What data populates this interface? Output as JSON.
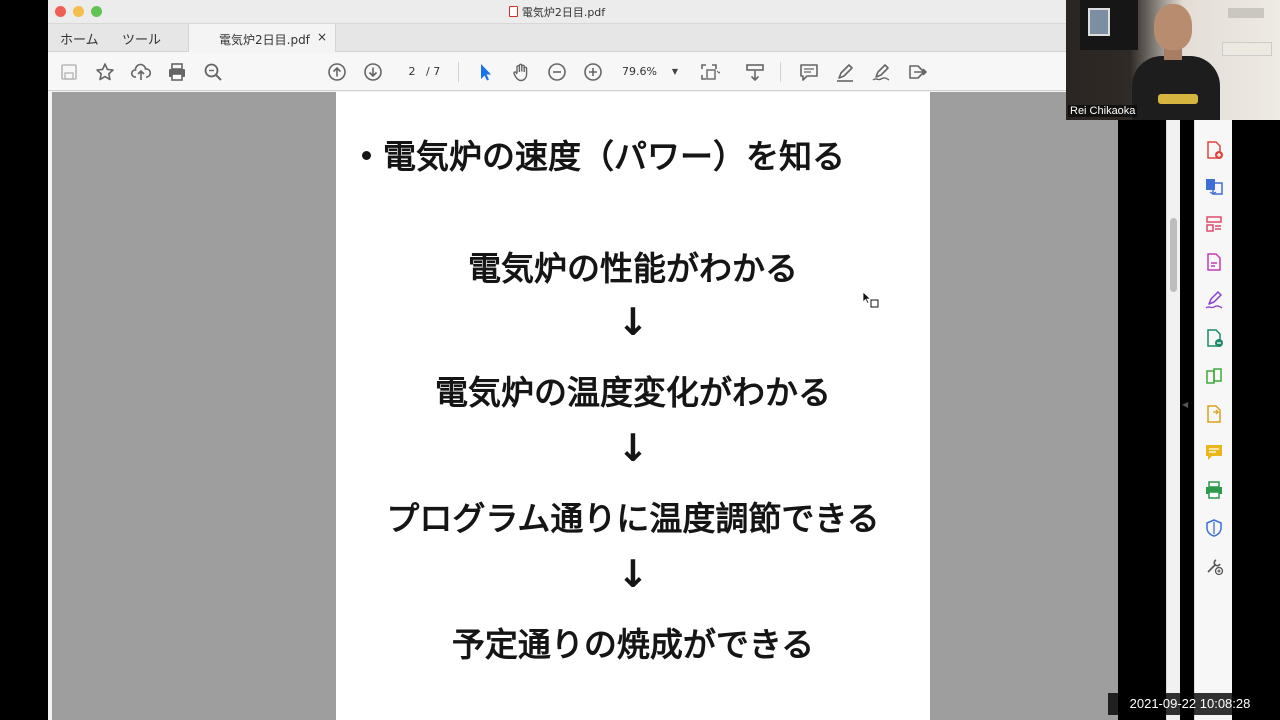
{
  "window": {
    "title": "電気炉2日目.pdf"
  },
  "tabs": {
    "home": "ホーム",
    "tools": "ツール",
    "document": "電気炉2日目.pdf",
    "close": "×"
  },
  "toolbar": {
    "current_page": "2",
    "total_pages": "/ 7",
    "zoom": "79.6%",
    "icons": [
      "save-icon",
      "bookmark-star-icon",
      "upload-icon",
      "print-icon",
      "zoom-search-icon",
      "page-up-icon",
      "page-down-icon",
      "select-cursor-icon",
      "hand-icon",
      "zoom-out-icon",
      "zoom-in-icon",
      "fit-page-icon",
      "scroll-mode-icon",
      "comment-icon",
      "highlight-pen-icon",
      "sign-icon",
      "share-icon"
    ]
  },
  "pdf": {
    "bullet": "電気炉の速度（パワー）を知る",
    "steps": [
      "電気炉の性能がわかる",
      "電気炉の温度変化がわかる",
      "プログラム通りに温度調節できる",
      "予定通りの焼成ができる"
    ],
    "arrow": "↓"
  },
  "video": {
    "participant": "Rei Chikaoka"
  },
  "timestamp": "2021-09-22 10:08:28",
  "colors": {
    "canvas": "#9e9e9e",
    "accent_blue": "#1a73e8",
    "close": "#ee5f57",
    "minimize": "#f5be4f",
    "maximize": "#5fc454"
  }
}
